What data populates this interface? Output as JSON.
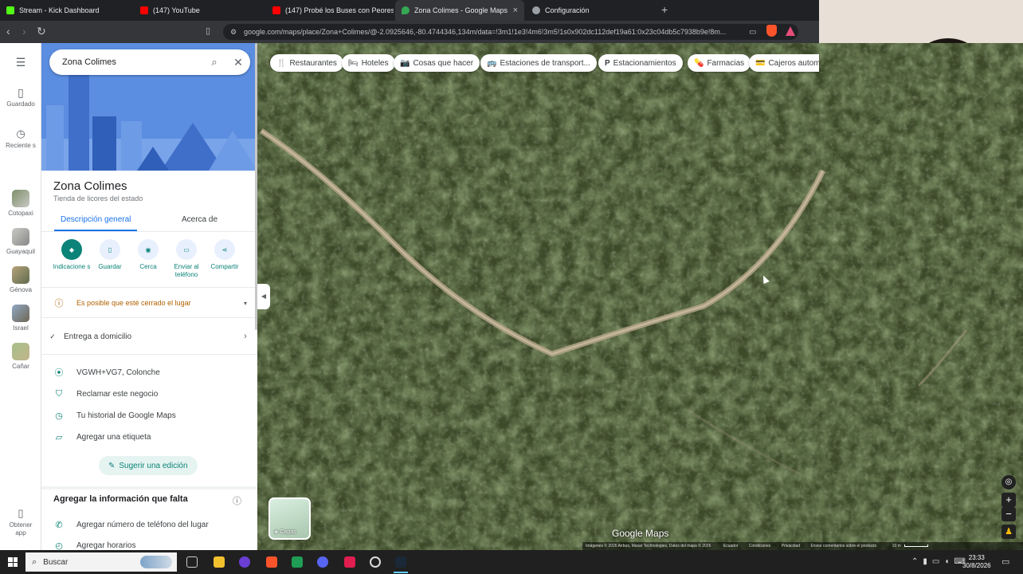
{
  "browser": {
    "tabs": [
      {
        "title": "Stream - Kick Dashboard",
        "color": "#53fc18",
        "active": false
      },
      {
        "title": "(147) YouTube",
        "color": "#ff0000",
        "active": false
      },
      {
        "title": "(147) Probé los Buses con Peores Re...",
        "color": "#ff0000",
        "active": false
      },
      {
        "title": "Zona Colimes - Google Maps",
        "color": "#34a853",
        "active": true
      },
      {
        "title": "Configuración",
        "color": "#9aa0a6",
        "active": false
      }
    ],
    "close_glyph": "×",
    "new_tab_glyph": "+",
    "url": "google.com/maps/place/Zona+Colimes/@-2.0925646,-80.4744346,134m/data=!3m1!1e3!4m6!3m5!1s0x902dc112def19a61:0x23c04db5c7938b9e!8m..."
  },
  "rail": {
    "menu_icon": "hamburger-icon",
    "items": [
      {
        "label": "Guardado",
        "icon": "bookmark-icon"
      },
      {
        "label": "Reciente s",
        "icon": "history-icon"
      },
      {
        "label": "Cotopaxi",
        "icon": "thumbnail"
      },
      {
        "label": "Guayaquil",
        "icon": "thumbnail"
      },
      {
        "label": "Génova",
        "icon": "thumbnail"
      },
      {
        "label": "Israel",
        "icon": "thumbnail"
      },
      {
        "label": "Cañar",
        "icon": "thumbnail"
      }
    ],
    "get_app_label": "Obtener app"
  },
  "panel": {
    "search_value": "Zona Colimes",
    "place_name": "Zona Colimes",
    "category": "Tienda de licores del estado",
    "tabs": [
      {
        "label": "Descripción general",
        "active": true
      },
      {
        "label": "Acerca de",
        "active": false
      }
    ],
    "actions": [
      {
        "label": "Indicacione s",
        "icon": "directions-icon"
      },
      {
        "label": "Guardar",
        "icon": "bookmark-icon"
      },
      {
        "label": "Cerca",
        "icon": "nearby-icon"
      },
      {
        "label": "Enviar al teléfono",
        "icon": "phone-icon"
      },
      {
        "label": "Compartir",
        "icon": "share-icon"
      }
    ],
    "closed_notice": "Es posible que esté cerrado el lugar",
    "delivery": "Entrega a domicilio",
    "info_rows": [
      {
        "text": "VGWH+VG7, Colonche",
        "icon": "location-pin-icon"
      },
      {
        "text": "Reclamar este negocio",
        "icon": "shield-check-icon"
      },
      {
        "text": "Tu historial de Google Maps",
        "icon": "history-icon"
      },
      {
        "text": "Agregar una etiqueta",
        "icon": "label-icon"
      }
    ],
    "suggest_edit": "Sugerir una edición",
    "missing_info_title": "Agregar la información que falta",
    "missing_rows": [
      {
        "text": "Agregar número de teléfono del lugar",
        "icon": "phone-icon"
      },
      {
        "text": "Agregar horarios",
        "icon": "clock-icon"
      }
    ]
  },
  "map": {
    "chips": [
      {
        "label": "Restaurantes",
        "icon": "🍴"
      },
      {
        "label": "Hoteles",
        "icon": "🛏"
      },
      {
        "label": "Cosas que hacer",
        "icon": "📷"
      },
      {
        "label": "Estaciones de transport...",
        "icon": "🚌"
      },
      {
        "label": "Estacionamientos",
        "icon": "P"
      },
      {
        "label": "Farmacias",
        "icon": "💊"
      },
      {
        "label": "Cajeros automa",
        "icon": "💳"
      }
    ],
    "layers_label": "Capas",
    "logo": "Google Maps",
    "attribution": "Imágenes © 2026 Airbus, Maxar Technologies, Datos del mapa © 2026",
    "footer_links": [
      "Ecuador",
      "Condiciones",
      "Privacidad",
      "Enviar comentarios sobre el producto"
    ],
    "scale": "10 m",
    "collapse_glyph": "◀"
  },
  "taskbar": {
    "search_label": "Buscar",
    "time": "23:33",
    "date": "30/8/2026"
  }
}
